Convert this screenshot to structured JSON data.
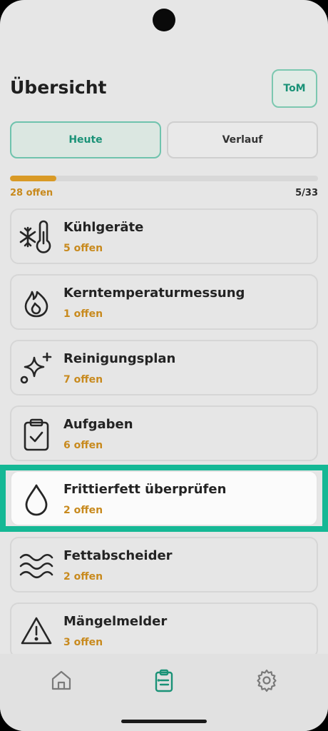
{
  "header": {
    "title": "Übersicht",
    "avatar_initials": "ToM"
  },
  "tabs": [
    {
      "label": "Heute",
      "active": true
    },
    {
      "label": "Verlauf",
      "active": false
    }
  ],
  "progress": {
    "open_label": "28 offen",
    "done": 5,
    "total": 33,
    "ratio_label": "5/33",
    "fraction": 0.15
  },
  "categories": [
    {
      "name": "Kühlgeräte",
      "open": "5 offen",
      "icon": "snowflake-thermometer-icon"
    },
    {
      "name": "Kerntemperaturmessung",
      "open": "1 offen",
      "icon": "flame-icon"
    },
    {
      "name": "Reinigungsplan",
      "open": "7 offen",
      "icon": "sparkle-icon"
    },
    {
      "name": "Aufgaben",
      "open": "6 offen",
      "icon": "clipboard-check-icon"
    },
    {
      "name": "Frittierfett überprüfen",
      "open": "2 offen",
      "icon": "droplet-icon",
      "highlighted": true
    },
    {
      "name": "Fettabscheider",
      "open": "2 offen",
      "icon": "waves-icon"
    },
    {
      "name": "Mängelmelder",
      "open": "3 offen",
      "icon": "warning-icon"
    }
  ],
  "bottom_nav": [
    {
      "icon": "home-icon",
      "active": false
    },
    {
      "icon": "clipboard-icon",
      "active": true
    },
    {
      "icon": "gear-icon",
      "active": false
    }
  ],
  "colors": {
    "accent": "#1a9277",
    "highlight_frame": "#15b895",
    "open_count": "#c88a1e",
    "progress": "#d99a26"
  }
}
